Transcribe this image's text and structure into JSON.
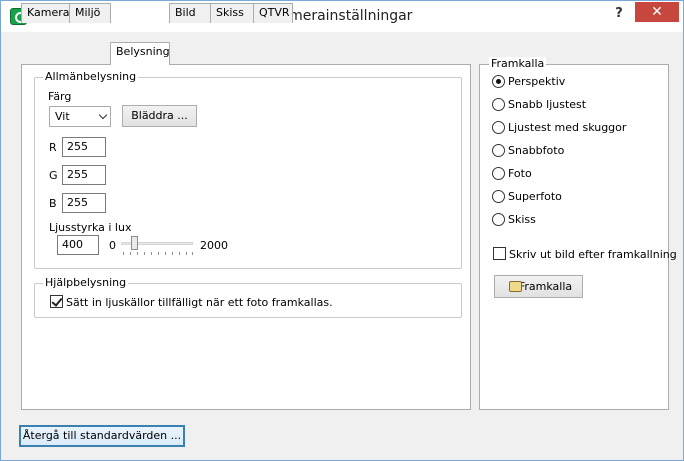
{
  "window": {
    "title": "Kamerainställningar",
    "help_label": "?",
    "close_label": "✕"
  },
  "tabs": [
    {
      "label": "Kamera"
    },
    {
      "label": "Miljö"
    },
    {
      "label": "Belysning",
      "active": true
    },
    {
      "label": "Bild"
    },
    {
      "label": "Skiss"
    },
    {
      "label": "QTVR"
    }
  ],
  "ambient": {
    "legend": "Allmänbelysning",
    "color_label": "Färg",
    "color_value": "Vit",
    "browse_label": "Bläddra ...",
    "r_label": "R",
    "r_value": "255",
    "g_label": "G",
    "g_value": "255",
    "b_label": "B",
    "b_value": "255",
    "intensity_label": "Ljusstyrka i lux",
    "intensity_value": "400",
    "slider_min": "0",
    "slider_max": "2000"
  },
  "help_lighting": {
    "legend": "Hjälpbelysning",
    "checkbox_label": "Sätt in ljuskällor tillfälligt när ett foto framkallas.",
    "checked": true
  },
  "render": {
    "legend": "Framkalla",
    "options": [
      {
        "label": "Perspektiv",
        "selected": true
      },
      {
        "label": "Snabb ljustest"
      },
      {
        "label": "Ljustest med skuggor"
      },
      {
        "label": "Snabbfoto"
      },
      {
        "label": "Foto"
      },
      {
        "label": "Superfoto"
      },
      {
        "label": "Skiss"
      }
    ],
    "print_label": "Skriv ut bild efter framkallning",
    "print_checked": false,
    "render_button": "Framkalla"
  },
  "footer": {
    "reset_label": "Återgå till standardvärden ..."
  }
}
